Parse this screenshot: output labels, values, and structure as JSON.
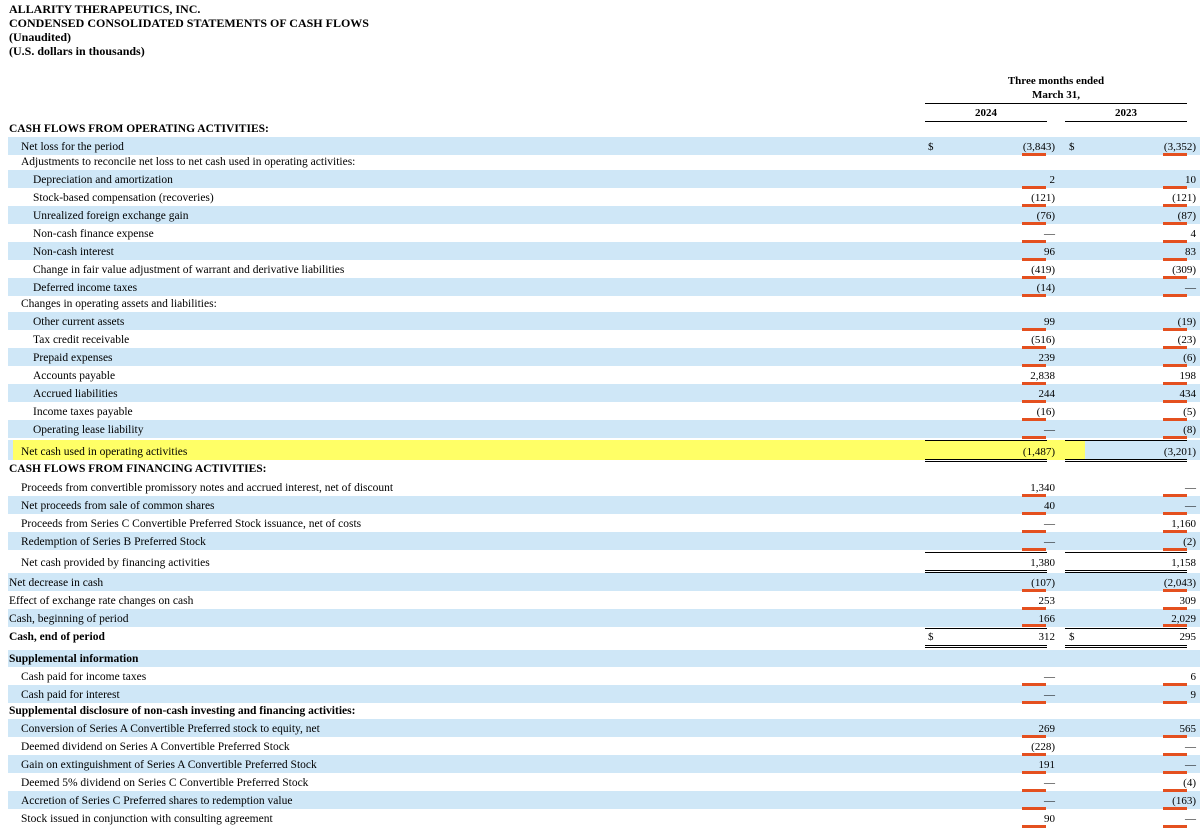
{
  "header": {
    "company": "ALLARITY THERAPEUTICS, INC.",
    "statement": "CONDENSED CONSOLIDATED STATEMENTS OF CASH FLOWS",
    "unaudited": "(Unaudited)",
    "units": "(U.S. dollars in thousands)"
  },
  "columns": {
    "period_line1": "Three months ended",
    "period_line2": "March 31,",
    "year_2024": "2024",
    "year_2023": "2023",
    "currency_symbol": "$"
  },
  "rows": [
    {
      "label": "CASH FLOWS FROM OPERATING ACTIVITIES:",
      "v2024": "",
      "v2023": ""
    },
    {
      "label": "Net loss for the period",
      "v2024": "(3,843)",
      "v2023": "(3,352)"
    },
    {
      "label": "Adjustments to reconcile net loss to net cash used in operating activities:",
      "v2024": "",
      "v2023": ""
    },
    {
      "label": "Depreciation and amortization",
      "v2024": "2",
      "v2023": "10"
    },
    {
      "label": "Stock-based compensation (recoveries)",
      "v2024": "(121)",
      "v2023": "(121)"
    },
    {
      "label": "Unrealized foreign exchange gain",
      "v2024": "(76)",
      "v2023": "(87)"
    },
    {
      "label": "Non-cash finance expense",
      "v2024": "—",
      "v2023": "4"
    },
    {
      "label": "Non-cash interest",
      "v2024": "96",
      "v2023": "83"
    },
    {
      "label": "Change in fair value adjustment of warrant and derivative liabilities",
      "v2024": "(419)",
      "v2023": "(309)"
    },
    {
      "label": "Deferred income taxes",
      "v2024": "(14)",
      "v2023": "—"
    },
    {
      "label": "Changes in operating assets and liabilities:",
      "v2024": "",
      "v2023": ""
    },
    {
      "label": "Other current assets",
      "v2024": "99",
      "v2023": "(19)"
    },
    {
      "label": "Tax credit receivable",
      "v2024": "(516)",
      "v2023": "(23)"
    },
    {
      "label": "Prepaid expenses",
      "v2024": "239",
      "v2023": "(6)"
    },
    {
      "label": "Accounts payable",
      "v2024": "2,838",
      "v2023": "198"
    },
    {
      "label": "Accrued liabilities",
      "v2024": "244",
      "v2023": "434"
    },
    {
      "label": "Income taxes payable",
      "v2024": "(16)",
      "v2023": "(5)"
    },
    {
      "label": "Operating lease liability",
      "v2024": "—",
      "v2023": "(8)"
    },
    {
      "label": "Net cash used in operating activities",
      "v2024": "(1,487)",
      "v2023": "(3,201)"
    },
    {
      "label": "CASH FLOWS FROM FINANCING ACTIVITIES:",
      "v2024": "",
      "v2023": ""
    },
    {
      "label": "Proceeds from convertible promissory notes and accrued interest, net of discount",
      "v2024": "1,340",
      "v2023": "—"
    },
    {
      "label": "Net proceeds from sale of common shares",
      "v2024": "40",
      "v2023": "—"
    },
    {
      "label": "Proceeds from Series C Convertible Preferred Stock issuance, net of costs",
      "v2024": "—",
      "v2023": "1,160"
    },
    {
      "label": "Redemption of Series B Preferred Stock",
      "v2024": "—",
      "v2023": "(2)"
    },
    {
      "label": "Net cash provided by financing activities",
      "v2024": "1,380",
      "v2023": "1,158"
    },
    {
      "label": "Net decrease in cash",
      "v2024": "(107)",
      "v2023": "(2,043)"
    },
    {
      "label": "Effect of exchange rate changes on cash",
      "v2024": "253",
      "v2023": "309"
    },
    {
      "label": "Cash, beginning of period",
      "v2024": "166",
      "v2023": "2,029"
    },
    {
      "label": "Cash, end of period",
      "v2024": "312",
      "v2023": "295"
    },
    {
      "label": "Supplemental information",
      "v2024": "",
      "v2023": ""
    },
    {
      "label": "Cash paid for income taxes",
      "v2024": "—",
      "v2023": "6"
    },
    {
      "label": "Cash paid for interest",
      "v2024": "—",
      "v2023": "9"
    },
    {
      "label": "Supplemental disclosure of non-cash investing and financing activities:",
      "v2024": "",
      "v2023": ""
    },
    {
      "label": "Conversion of Series A Convertible Preferred stock to equity, net",
      "v2024": "269",
      "v2023": "565"
    },
    {
      "label": "Deemed dividend on Series A Convertible Preferred Stock",
      "v2024": "(228)",
      "v2023": "—"
    },
    {
      "label": "Gain on extinguishment of Series A Convertible Preferred Stock",
      "v2024": "191",
      "v2023": "—"
    },
    {
      "label": "Deemed 5% dividend on Series C Convertible Preferred Stock",
      "v2024": "—",
      "v2023": "(4)"
    },
    {
      "label": "Accretion of Series C Preferred shares to redemption value",
      "v2024": "—",
      "v2023": "(163)"
    },
    {
      "label": "Stock issued in conjunction with consulting agreement",
      "v2024": "90",
      "v2023": "—"
    }
  ]
}
